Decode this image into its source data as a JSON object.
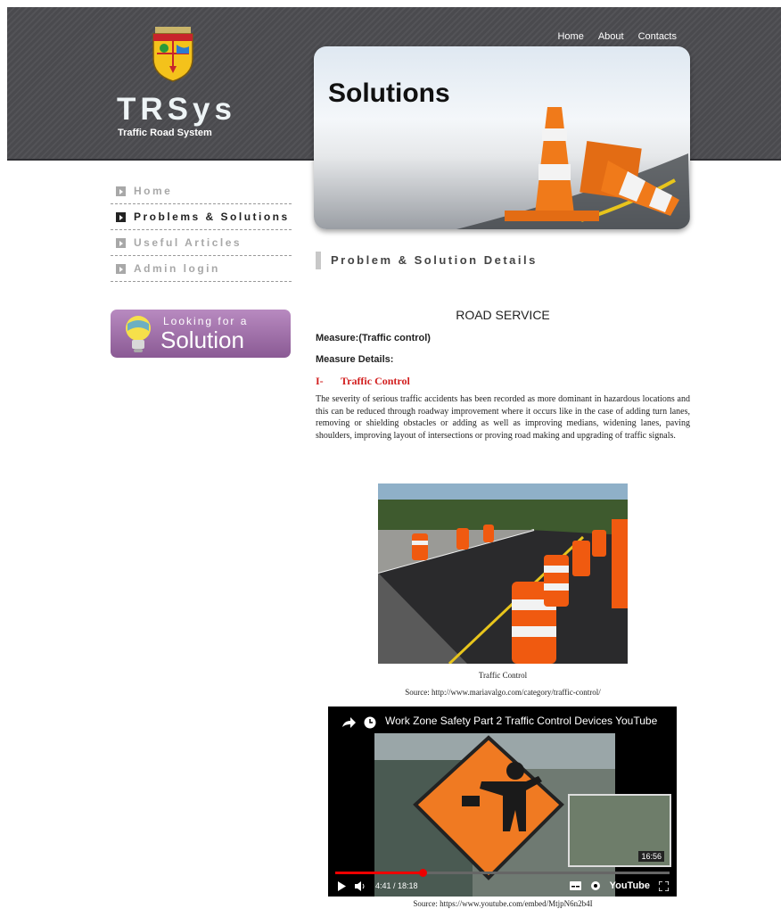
{
  "top_nav": [
    "Home",
    "About",
    "Contacts"
  ],
  "brand": {
    "name": "TRSys",
    "tagline": "Traffic Road System"
  },
  "hero": {
    "title": "Solutions"
  },
  "sidebar": {
    "items": [
      {
        "label": "Home",
        "active": false
      },
      {
        "label": "Problems & Solutions",
        "active": true
      },
      {
        "label": "Useful Articles",
        "active": false
      },
      {
        "label": "Admin login",
        "active": false
      }
    ],
    "promo": {
      "line1": "Looking for a",
      "line2": "Solution"
    }
  },
  "section_heading": "Problem & Solution Details",
  "content": {
    "title": "ROAD SERVICE",
    "measure": "Measure:(Traffic control)",
    "measure_details": "Measure Details:",
    "subheading_num": "I-",
    "subheading": "Traffic Control",
    "paragraph": "The severity of serious traffic accidents has been recorded as more dominant in hazardous locations and this can be reduced through roadway improvement where it occurs like in the case of adding turn lanes, removing or shielding obstacles or adding as well as improving medians, widening lanes, paving shoulders, improving layout of intersections or proving road making and upgrading of traffic signals.",
    "photo_caption": "Traffic Control",
    "photo_source": "Source:  http://www.mariavalgo.com/category/traffic-control/",
    "video": {
      "title": "Work Zone Safety Part 2 Traffic Control Devices YouTube",
      "thumb_time": "16:56",
      "time": "4:41 / 18:18",
      "progress": 0.26,
      "brand": "YouTube"
    },
    "video_source": "Source:  https://www.youtube.com/embed/MtjpN6n2b4I"
  },
  "colors": {
    "header": "#4a4a4e",
    "accent_red": "#d21f1f",
    "promo": "#9a6aa4"
  }
}
